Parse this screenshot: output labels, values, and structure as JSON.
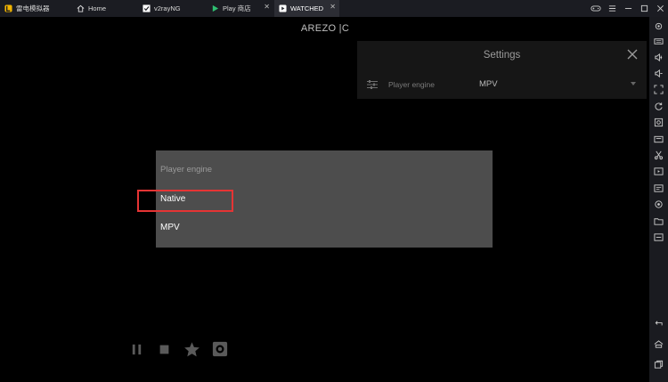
{
  "tabs": [
    {
      "label": "雷电模拟器",
      "icon": "ldplayer-logo-icon"
    },
    {
      "label": "Home",
      "icon": "home-icon"
    },
    {
      "label": "v2rayNG",
      "icon": "v2rayng-icon"
    },
    {
      "label": "Play 商店",
      "icon": "play-store-icon"
    },
    {
      "label": "WATCHED",
      "icon": "watched-app-icon"
    }
  ],
  "app_title": "AREZO |C",
  "settings": {
    "title": "Settings",
    "row_label": "Player engine",
    "row_value": "MPV"
  },
  "dialog": {
    "title": "Player engine",
    "options": [
      "Native",
      "MPV"
    ]
  },
  "colors": {
    "highlight": "#e53434",
    "dialog_bg": "#4d4d4d",
    "settings_bg": "#161616"
  }
}
